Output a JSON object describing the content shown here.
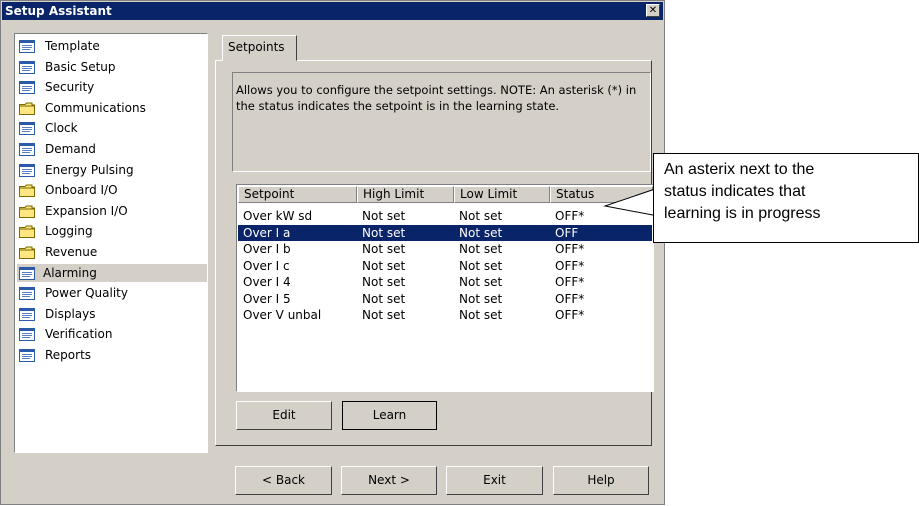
{
  "window": {
    "title": "Setup Assistant",
    "close_glyph": "✕"
  },
  "sidebar": {
    "items": [
      {
        "label": "Template",
        "icon": "document-icon"
      },
      {
        "label": "Basic Setup",
        "icon": "document-icon"
      },
      {
        "label": "Security",
        "icon": "document-icon"
      },
      {
        "label": "Communications",
        "icon": "folder-icon"
      },
      {
        "label": "Clock",
        "icon": "document-icon"
      },
      {
        "label": "Demand",
        "icon": "document-icon"
      },
      {
        "label": "Energy Pulsing",
        "icon": "document-icon"
      },
      {
        "label": "Onboard I/O",
        "icon": "folder-icon"
      },
      {
        "label": "Expansion I/O",
        "icon": "folder-icon"
      },
      {
        "label": "Logging",
        "icon": "folder-icon"
      },
      {
        "label": "Revenue",
        "icon": "folder-icon"
      },
      {
        "label": "Alarming",
        "icon": "document-icon",
        "selected": true
      },
      {
        "label": "Power Quality",
        "icon": "document-icon"
      },
      {
        "label": "Displays",
        "icon": "document-icon"
      },
      {
        "label": "Verification",
        "icon": "document-icon"
      },
      {
        "label": "Reports",
        "icon": "document-icon"
      }
    ]
  },
  "tabs": [
    {
      "label": "Setpoints",
      "active": true
    }
  ],
  "description": "Allows you to configure the setpoint settings. NOTE: An asterisk (*) in the status indicates the setpoint is in the learning state.",
  "table": {
    "columns": [
      "Setpoint",
      "High Limit",
      "Low Limit",
      "Status"
    ],
    "rows": [
      [
        "Over kW sd",
        "Not set",
        "Not set",
        "OFF*"
      ],
      [
        "Over I a",
        "Not set",
        "Not set",
        "OFF"
      ],
      [
        "Over I b",
        "Not set",
        "Not set",
        "OFF*"
      ],
      [
        "Over I c",
        "Not set",
        "Not set",
        "OFF*"
      ],
      [
        "Over I 4",
        "Not set",
        "Not set",
        "OFF*"
      ],
      [
        "Over I 5",
        "Not set",
        "Not set",
        "OFF*"
      ],
      [
        "Over V unbal",
        "Not set",
        "Not set",
        "OFF*"
      ]
    ],
    "selected_row": 1
  },
  "buttons": {
    "edit": "Edit",
    "learn": "Learn",
    "back": "< Back",
    "next": "Next >",
    "exit": "Exit",
    "help": "Help"
  },
  "callout": {
    "lines": [
      "An asterix next to the",
      "status indicates that",
      "learning is in progress"
    ]
  },
  "colors": {
    "selection": "#0a246a",
    "face": "#d4d0c8",
    "folder": "#ffe680",
    "doc_icon": "#2a5aa8"
  }
}
